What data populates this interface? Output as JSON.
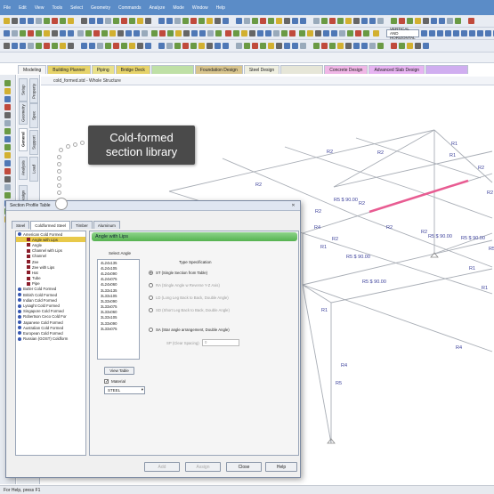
{
  "menu": [
    "File",
    "Edit",
    "View",
    "Tools",
    "Select",
    "Geometry",
    "Commands",
    "Analyze",
    "Mode",
    "Window",
    "Help"
  ],
  "toolbar": {
    "view_select": "VERTICAL AND HORIZONTAL"
  },
  "mode_tabs": [
    {
      "label": "Modeling",
      "bg": "#f4f4f4"
    },
    {
      "label": "Building Planner",
      "bg": "#e6d36a"
    },
    {
      "label": "Piping",
      "bg": "#e8e08a"
    },
    {
      "label": "Bridge Deck",
      "bg": "#e6d36a"
    },
    {
      "label": "",
      "bg": "#bfe0a6"
    },
    {
      "label": "Foundation Design",
      "bg": "#d8c58e"
    },
    {
      "label": "Steel Design",
      "bg": "#efefe0"
    },
    {
      "label": "",
      "bg": "#e6e6d8"
    },
    {
      "label": "Concrete Design",
      "bg": "#f0b7e6"
    },
    {
      "label": "Advanced Slab Design",
      "bg": "#e7b4f2"
    },
    {
      "label": "",
      "bg": "#d0aef0"
    }
  ],
  "left_tabs": [
    "Setup",
    "Geometry",
    "General",
    "Analysis",
    "Design",
    "Property",
    "Spec",
    "Support",
    "Load"
  ],
  "document": {
    "title": "cold_formed.std - Whole Structure"
  },
  "callout": {
    "line1": "Cold-formed",
    "line2": "section library"
  },
  "structure_labels": [
    "R1",
    "R2",
    "R2",
    "R2",
    "R2",
    "R2",
    "R2",
    "R2",
    "R2",
    "R2",
    "R1",
    "R4",
    "R5 $ 90.00",
    "R5 $ 90.00",
    "R5 $ 90.00",
    "R5 $ 90.00",
    "R5 $ 90.00",
    "R5 $ 90.00",
    "R1",
    "R4",
    "R5",
    "R2",
    "R1",
    "R1",
    "R4",
    "R1"
  ],
  "dialog": {
    "title": "Section Profile Table",
    "tabs": [
      "Steel",
      "Coldformed Steel",
      "Timber",
      "Aluminum"
    ],
    "tree": [
      {
        "label": "American Cold Formed",
        "level": "top",
        "selected": false
      },
      {
        "label": "Angle with Lips",
        "level": "sub",
        "selected": true
      },
      {
        "label": "Angle",
        "level": "sub",
        "selected": false
      },
      {
        "label": "Channel with Lips",
        "level": "sub",
        "selected": false
      },
      {
        "label": "Channel",
        "level": "sub",
        "selected": false
      },
      {
        "label": "Zee",
        "level": "sub",
        "selected": false
      },
      {
        "label": "Zee with Lips",
        "level": "sub",
        "selected": false
      },
      {
        "label": "Hat",
        "level": "sub",
        "selected": false
      },
      {
        "label": "Tube",
        "level": "sub",
        "selected": false
      },
      {
        "label": "Pipe",
        "level": "sub",
        "selected": false
      },
      {
        "label": "Butler Cold Formed",
        "level": "top",
        "selected": false
      },
      {
        "label": "British Cold Formed",
        "level": "top",
        "selected": false
      },
      {
        "label": "Indian Cold Formed",
        "level": "top",
        "selected": false
      },
      {
        "label": "Lysaght Cold Formed",
        "level": "top",
        "selected": false
      },
      {
        "label": "Singapore Cold Formed",
        "level": "top",
        "selected": false
      },
      {
        "label": "Robertson Ceco Cold For",
        "level": "top",
        "selected": false
      },
      {
        "label": "Japanese Cold Formed",
        "level": "top",
        "selected": false
      },
      {
        "label": "Australian Cold Formed",
        "level": "top",
        "selected": false
      },
      {
        "label": "European Cold Formed",
        "level": "top",
        "selected": false
      },
      {
        "label": "Russian (GOST) Coldform",
        "level": "top",
        "selected": false
      }
    ],
    "panel_title": "Angle with Lips",
    "select_angle_label": "Select Angle",
    "angles": [
      "4L24x135",
      "4L24x105",
      "4L24x090",
      "4L24x075",
      "4L24x060",
      "3L33x135",
      "3L33x105",
      "3L33x090",
      "3L33x075",
      "3L33x060",
      "3L33x105",
      "3L33x090",
      "3L33x075"
    ],
    "type_spec_label": "Type Specification",
    "type_options": [
      {
        "label": "ST (Single Section from Table)",
        "selected": true,
        "enabled": true
      },
      {
        "label": "RA (Single Angle w Reverse Y-Z Axis)",
        "selected": false,
        "enabled": false
      },
      {
        "label": "LD (Long Leg Back to Back, Double Angle)",
        "selected": false,
        "enabled": false
      },
      {
        "label": "SD (Short Leg Back to Back, Double Angle)",
        "selected": false,
        "enabled": false
      },
      {
        "label": "SA (Star angle arrangement, Double Angle)",
        "selected": false,
        "enabled": true
      }
    ],
    "spacing_label": "SP (Clear Spacing)",
    "spacing_value": "0",
    "view_table_label": "View Table",
    "material_label": "Material",
    "material_checked": "✓",
    "material_value": "STEEL",
    "buttons": {
      "add": "Add",
      "assign": "Assign",
      "close": "Close",
      "help": "Help"
    }
  },
  "status": {
    "text": "For Help, press F1"
  },
  "colors": {
    "accent_highlight": "#e85c92",
    "node_labels": "#3a3f9a",
    "menubar": "#5b8cc7"
  }
}
